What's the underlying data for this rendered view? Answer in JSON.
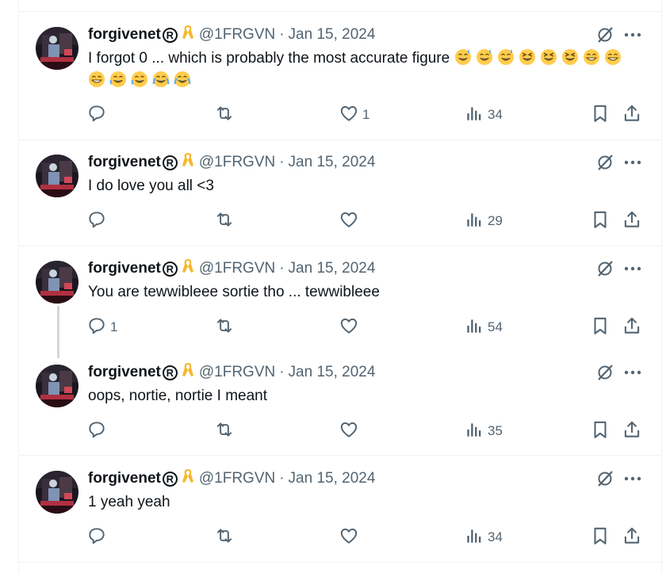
{
  "tweets": [
    {
      "name": "forgivenet",
      "reg": "R",
      "handle": "@1FRGVN",
      "date": "Jan 15, 2024",
      "text": "I forgot 0 ... which is probably the most accurate figure",
      "emojis": [
        "sweat-smile",
        "sweat-smile",
        "sweat-smile",
        "laughing",
        "laughing",
        "laughing",
        "grin",
        "grin",
        "grin",
        "rofl",
        "rofl",
        "joy",
        "joy"
      ],
      "replies": "",
      "retweets": "",
      "likes": "1",
      "views": "34"
    },
    {
      "name": "forgivenet",
      "reg": "R",
      "handle": "@1FRGVN",
      "date": "Jan 15, 2024",
      "text": "I do love you all <3",
      "emojis": [],
      "replies": "",
      "retweets": "",
      "likes": "",
      "views": "29"
    },
    {
      "name": "forgivenet",
      "reg": "R",
      "handle": "@1FRGVN",
      "date": "Jan 15, 2024",
      "text": "You are tewwibleee sortie tho ... tewwibleee",
      "emojis": [],
      "replies": "1",
      "retweets": "",
      "likes": "",
      "views": "54"
    },
    {
      "name": "forgivenet",
      "reg": "R",
      "handle": "@1FRGVN",
      "date": "Jan 15, 2024",
      "text": "oops, nortie, nortie I meant",
      "emojis": [],
      "replies": "",
      "retweets": "",
      "likes": "",
      "views": "35"
    },
    {
      "name": "forgivenet",
      "reg": "R",
      "handle": "@1FRGVN",
      "date": "Jan 15, 2024",
      "text": "1 yeah yeah",
      "emojis": [],
      "replies": "",
      "retweets": "",
      "likes": "",
      "views": "34"
    }
  ],
  "colors": {
    "text": "#0f1419",
    "muted": "#536471",
    "border": "#eff3f4",
    "thread": "#cfd9de",
    "emoji": "#ffcc4d"
  },
  "icons": {
    "reply": "reply-icon",
    "retweet": "retweet-icon",
    "like": "heart-icon",
    "views": "views-icon",
    "bookmark": "bookmark-icon",
    "share": "share-icon",
    "grok": "grok-icon",
    "more": "more-icon",
    "ribbon": "ribbon-icon"
  }
}
